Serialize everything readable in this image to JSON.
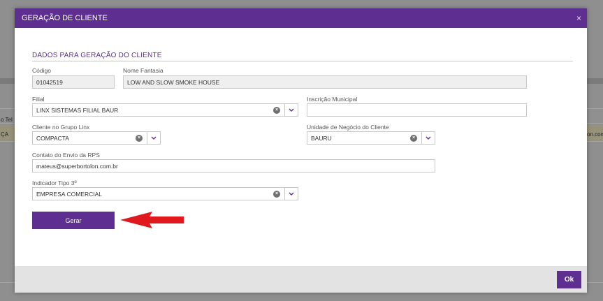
{
  "background": {
    "row1_left_text": "o Tel",
    "row2_left_text": "ÇA",
    "row2_right_text": "on.com"
  },
  "modal": {
    "title": "GERAÇÃO DE CLIENTE",
    "close_glyph": "×",
    "section_title": "DADOS PARA GERAÇÃO DO CLIENTE",
    "fields": {
      "codigo": {
        "label": "Código",
        "value": "01042519"
      },
      "nome_fantasia": {
        "label": "Nome Fantasia",
        "value": "LOW AND SLOW SMOKE HOUSE"
      },
      "filial": {
        "label": "Filial",
        "value": "LINX SISTEMAS FILIAL BAUR"
      },
      "inscricao_municipal": {
        "label": "Inscrição Municipal",
        "value": ""
      },
      "cliente_grupo_linx": {
        "label": "Cliente no Grupo Linx",
        "value": "COMPACTA"
      },
      "unidade_negocio": {
        "label": "Unidade de Negócio do Cliente",
        "value": "BAURU"
      },
      "contato_rps": {
        "label": "Contato do Envio da RPS",
        "value": "mateus@superbortolon.com.br"
      },
      "indicador_tipo": {
        "label": "Indicador Tipo 3º",
        "value": "EMPRESA COMERCIAL"
      }
    },
    "gerar_button": "Gerar",
    "ok_button": "Ok"
  },
  "colors": {
    "brand": "#5f2e91",
    "arrow": "#e0191f"
  },
  "icons": {
    "clear": "clear-icon",
    "dropdown": "chevron-down-icon",
    "close": "close-icon",
    "pointer": "red-arrow-icon"
  }
}
